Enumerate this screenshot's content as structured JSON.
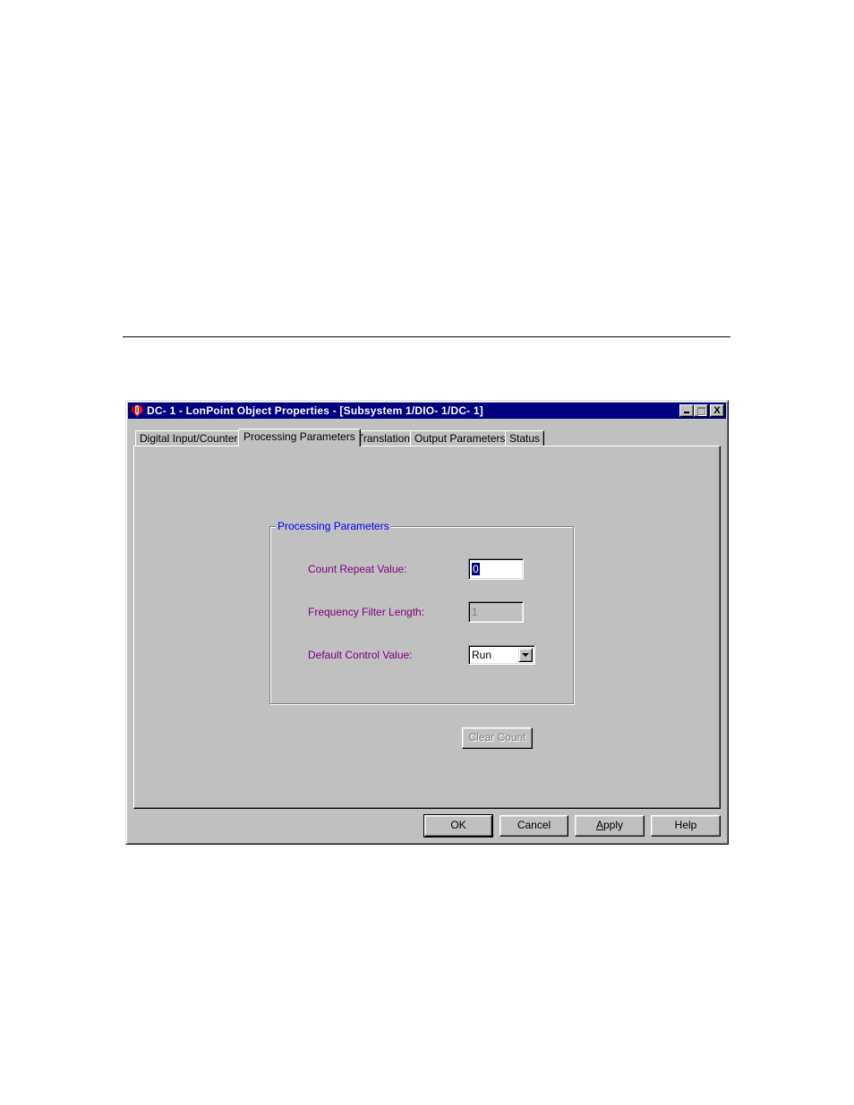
{
  "dialog": {
    "title": "DC- 1 - LonPoint Object Properties - [Subsystem 1/DIO- 1/DC- 1]",
    "title_icon": "lonpoint-app-icon",
    "window_buttons": {
      "minimize": "_",
      "maximize": "",
      "close": "X"
    },
    "tabs": [
      {
        "label": "Digital Input/Counter",
        "active": false
      },
      {
        "label": "Processing Parameters",
        "active": true
      },
      {
        "label": "Translation",
        "active": false
      },
      {
        "label": "Output Parameters",
        "active": false
      },
      {
        "label": "Status",
        "active": false
      }
    ],
    "group": {
      "title": "Processing Parameters",
      "fields": {
        "count_repeat": {
          "label": "Count Repeat Value:",
          "value": "0",
          "selected": true,
          "enabled": true
        },
        "freq_filter": {
          "label": "Frequency Filter Length:",
          "value": "1",
          "enabled": false
        },
        "default_control": {
          "label": "Default Control Value:",
          "value": "Run"
        }
      }
    },
    "clear_count_label": "Clear Count",
    "buttons": {
      "ok": "OK",
      "cancel": "Cancel",
      "apply": "Apply",
      "help": "Help"
    }
  },
  "colors": {
    "titlebar": "#000080",
    "field_label": "#800080",
    "group_title": "#0000ff",
    "face": "#c0c0c0"
  }
}
